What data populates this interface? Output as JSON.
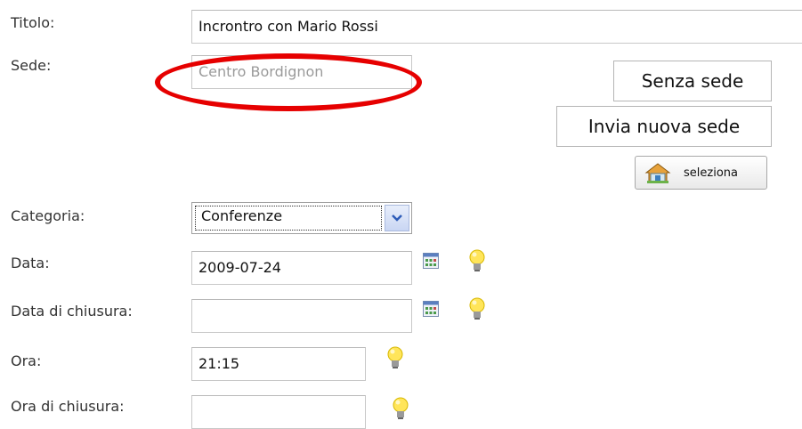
{
  "form": {
    "titolo": {
      "label": "Titolo:",
      "value": "Incrontro con Mario Rossi"
    },
    "sede": {
      "label": "Sede:",
      "value": "Centro Bordignon",
      "buttons": {
        "senza_sede": "Senza sede",
        "invia_nuova_sede": "Invia nuova sede",
        "seleziona": "seleziona"
      }
    },
    "categoria": {
      "label": "Categoria:",
      "selected": "Conferenze"
    },
    "data": {
      "label": "Data:",
      "value": "2009-07-24"
    },
    "data_chiusura": {
      "label": "Data di chiusura:",
      "value": ""
    },
    "ora": {
      "label": "Ora:",
      "value": "21:15"
    },
    "ora_chiusura": {
      "label": "Ora di chiusura:",
      "value": ""
    }
  },
  "colors": {
    "highlight_ellipse": "#e60000",
    "select_arrow": "#2e5cb8"
  },
  "icons": {
    "calendar": "calendar-icon",
    "bulb": "lightbulb-icon",
    "home": "home-icon",
    "dropdown": "chevron-down-icon"
  }
}
